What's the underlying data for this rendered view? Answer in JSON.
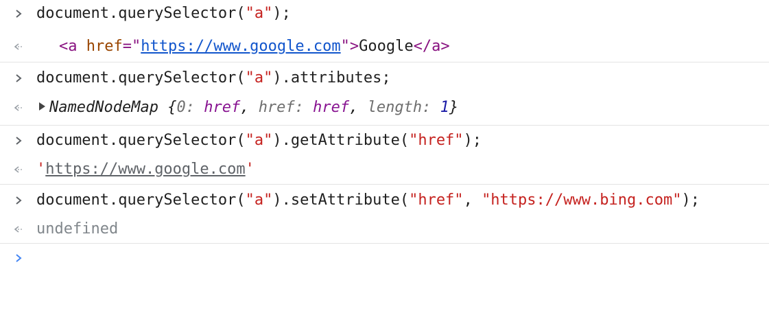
{
  "entries": [
    {
      "input": {
        "code": "document.querySelector(",
        "arg": "\"a\"",
        "end": ");"
      },
      "output": {
        "tag_open": "<a",
        "attr": "href",
        "eq": "=\"",
        "url": "https://www.google.com",
        "close_q": "\"",
        "gt": ">",
        "text": "Google",
        "tag_close": "</a>"
      }
    },
    {
      "input": {
        "code": "document.querySelector(",
        "arg": "\"a\"",
        "end": ").attributes;"
      },
      "output": {
        "type_name": "NamedNodeMap",
        "brace_open": "{",
        "k0": "0:",
        "v0": "href",
        "sep1": ",",
        "k1": "href:",
        "v1": "href",
        "sep2": ",",
        "k2": "length:",
        "v2": "1",
        "brace_close": "}"
      }
    },
    {
      "input": {
        "code": "document.querySelector(",
        "arg": "\"a\"",
        "mid": ").getAttribute(",
        "arg2": "\"href\"",
        "end": ");"
      },
      "output": {
        "q1": "'",
        "value": "https://www.google.com",
        "q2": "'"
      }
    },
    {
      "input": {
        "code": "document.querySelector(",
        "arg": "\"a\"",
        "mid": ").setAttribute(",
        "arg2": "\"href\"",
        "comma": ", ",
        "arg3": "\"https://www.bing.com\"",
        "end": ");"
      },
      "output": {
        "value": "undefined"
      }
    }
  ],
  "icons": {
    "input_prompt": "chevron-right-icon",
    "output_prompt": "return-arrow-icon",
    "active_prompt": "chevron-right-icon",
    "expand": "expand-triangle-icon"
  },
  "colors": {
    "string": "#c5221f",
    "tag": "#881280",
    "attribute": "#994500",
    "link": "#1155cc",
    "property_value": "#881391",
    "number": "#1a1aa6",
    "muted": "#80868b",
    "active_prompt": "#4285f4"
  }
}
